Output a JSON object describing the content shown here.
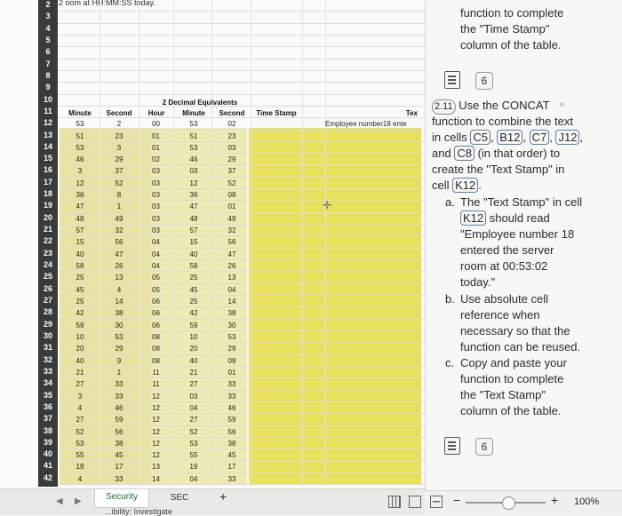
{
  "top_note": "2 oom at HH:MM:SS today.",
  "row_numbers": [
    "2",
    "3",
    "4",
    "5",
    "6",
    "7",
    "8",
    "9",
    "10",
    "11",
    "12",
    "13",
    "14",
    "15",
    "16",
    "17",
    "18",
    "19",
    "20",
    "21",
    "22",
    "23",
    "24",
    "25",
    "26",
    "27",
    "28",
    "29",
    "30",
    "31",
    "32",
    "33",
    "34",
    "35",
    "36",
    "37",
    "38",
    "39",
    "40",
    "41",
    "42"
  ],
  "group_header": "2 Decimal Equivalents",
  "columns": {
    "minute": "Minute",
    "second": "Second",
    "hour": "Hour",
    "minute2": "Minute",
    "second2": "Second",
    "timestamp": "Time Stamp",
    "text_header": "Tex",
    "employee_text": "Employee number18 ente"
  },
  "rows": [
    [
      "53",
      "2",
      "00",
      "53",
      "02"
    ],
    [
      "51",
      "23",
      "01",
      "51",
      "23"
    ],
    [
      "53",
      "3",
      "01",
      "53",
      "03"
    ],
    [
      "46",
      "29",
      "02",
      "46",
      "29"
    ],
    [
      "3",
      "37",
      "03",
      "03",
      "37"
    ],
    [
      "12",
      "52",
      "03",
      "12",
      "52"
    ],
    [
      "36",
      "8",
      "03",
      "36",
      "08"
    ],
    [
      "47",
      "1",
      "03",
      "47",
      "01"
    ],
    [
      "48",
      "49",
      "03",
      "48",
      "49"
    ],
    [
      "57",
      "32",
      "03",
      "57",
      "32"
    ],
    [
      "15",
      "56",
      "04",
      "15",
      "56"
    ],
    [
      "40",
      "47",
      "04",
      "40",
      "47"
    ],
    [
      "58",
      "26",
      "04",
      "58",
      "26"
    ],
    [
      "25",
      "13",
      "05",
      "25",
      "13"
    ],
    [
      "45",
      "4",
      "05",
      "45",
      "04"
    ],
    [
      "25",
      "14",
      "06",
      "25",
      "14"
    ],
    [
      "42",
      "38",
      "06",
      "42",
      "38"
    ],
    [
      "59",
      "30",
      "06",
      "59",
      "30"
    ],
    [
      "10",
      "53",
      "08",
      "10",
      "53"
    ],
    [
      "20",
      "29",
      "08",
      "20",
      "29"
    ],
    [
      "40",
      "9",
      "08",
      "40",
      "09"
    ],
    [
      "21",
      "1",
      "11",
      "21",
      "01"
    ],
    [
      "27",
      "33",
      "11",
      "27",
      "33"
    ],
    [
      "3",
      "33",
      "12",
      "03",
      "33"
    ],
    [
      "4",
      "46",
      "12",
      "04",
      "46"
    ],
    [
      "27",
      "59",
      "12",
      "27",
      "59"
    ],
    [
      "52",
      "56",
      "12",
      "52",
      "56"
    ],
    [
      "53",
      "38",
      "12",
      "53",
      "38"
    ],
    [
      "55",
      "45",
      "12",
      "55",
      "45"
    ],
    [
      "19",
      "17",
      "13",
      "19",
      "17"
    ],
    [
      "4",
      "33",
      "14",
      "04",
      "33"
    ]
  ],
  "sheet_tabs": {
    "active": "Security",
    "second": "SEC",
    "add": "+",
    "bottom_label": "...ibility: Investigate"
  },
  "panel": {
    "intro": [
      "function to complete",
      "the \"Time Stamp\"",
      "column of the table."
    ],
    "badge": "6",
    "task_num": "2.11",
    "task_lines": [
      "Use the CONCAT",
      "function to combine the text",
      "in cells",
      "and",
      "(in that order) to",
      "create the \"Text Stamp\" in",
      "cell"
    ],
    "cells": [
      "C5",
      "B12",
      "C7",
      "J12",
      "C8",
      "K12"
    ],
    "a_lines": [
      "The \"Text Stamp\" in cell",
      "should read",
      "\"Employee number 18",
      "entered the server",
      "room at 00:53:02",
      "today.\""
    ],
    "b_lines": [
      "Use absolute cell",
      "reference when",
      "necessary so that the",
      "function can be reused."
    ],
    "c_lines": [
      "Copy and paste your",
      "function to complete",
      "the \"Text Stamp\"",
      "column of the table."
    ],
    "labels": {
      "a": "a.",
      "b": "b.",
      "c": "c."
    }
  },
  "zoom": "100%",
  "colors": {
    "yellow": "#e8e15c",
    "row_header_bg": "#3a3a3a",
    "chip_border": "#5a7fb0"
  }
}
